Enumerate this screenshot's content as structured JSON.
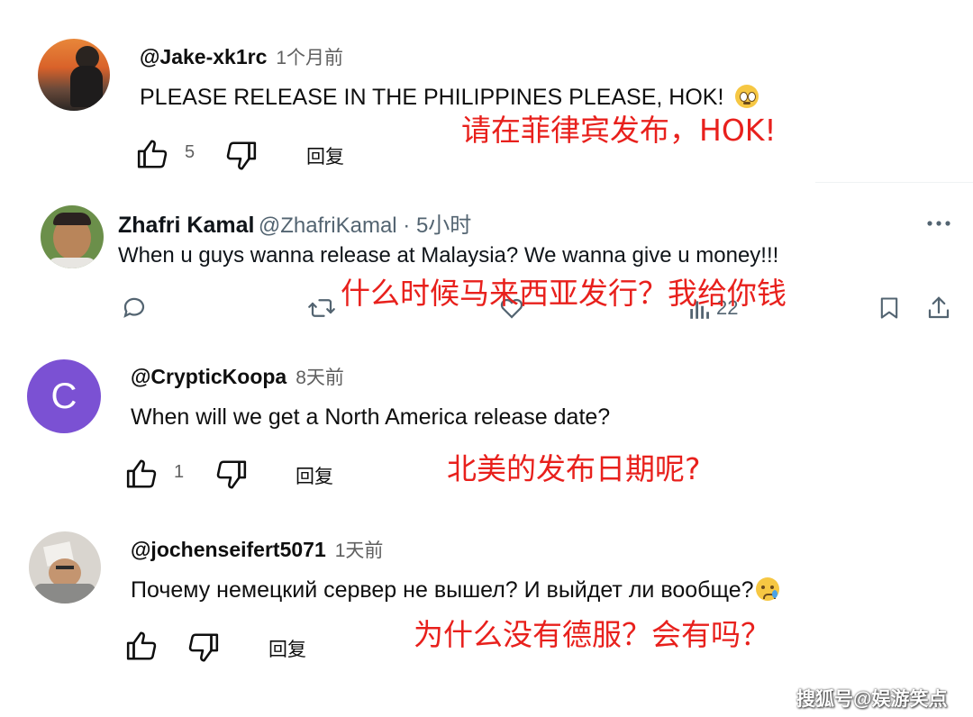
{
  "comments": [
    {
      "username": "@Jake-xk1rc",
      "time": "1个月前",
      "text": "PLEASE RELEASE IN THE PHILIPPINES PLEASE, HOK!",
      "emoji": "pleading-face",
      "likes": "5",
      "reply_label": "回复",
      "translation": "请在菲律宾发布，HOK!"
    },
    {
      "name": "Zhafri Kamal",
      "handle": "@ZhafriKamal · 5小时",
      "text": "When u guys wanna release at Malaysia? We wanna give u money!!!",
      "views": "22",
      "translation": "什么时候马来西亚发行？我给你钱"
    },
    {
      "username": "@CrypticKoopa",
      "time": "8天前",
      "avatar_letter": "C",
      "text": "When will we get a North America release date?",
      "likes": "1",
      "reply_label": "回复",
      "translation": "北美的发布日期呢?"
    },
    {
      "username": "@jochenseifert5071",
      "time": "1天前",
      "text": "Почему немецкий сервер не вышел? И выйдет ли вообще?",
      "emoji": "crying-face",
      "reply_label": "回复",
      "translation": "为什么没有德服？会有吗？"
    }
  ],
  "watermark": "搜狐号@娱游笑点",
  "colors": {
    "translation_red": "#e8201c",
    "avatar_purple": "#7b51d3"
  }
}
